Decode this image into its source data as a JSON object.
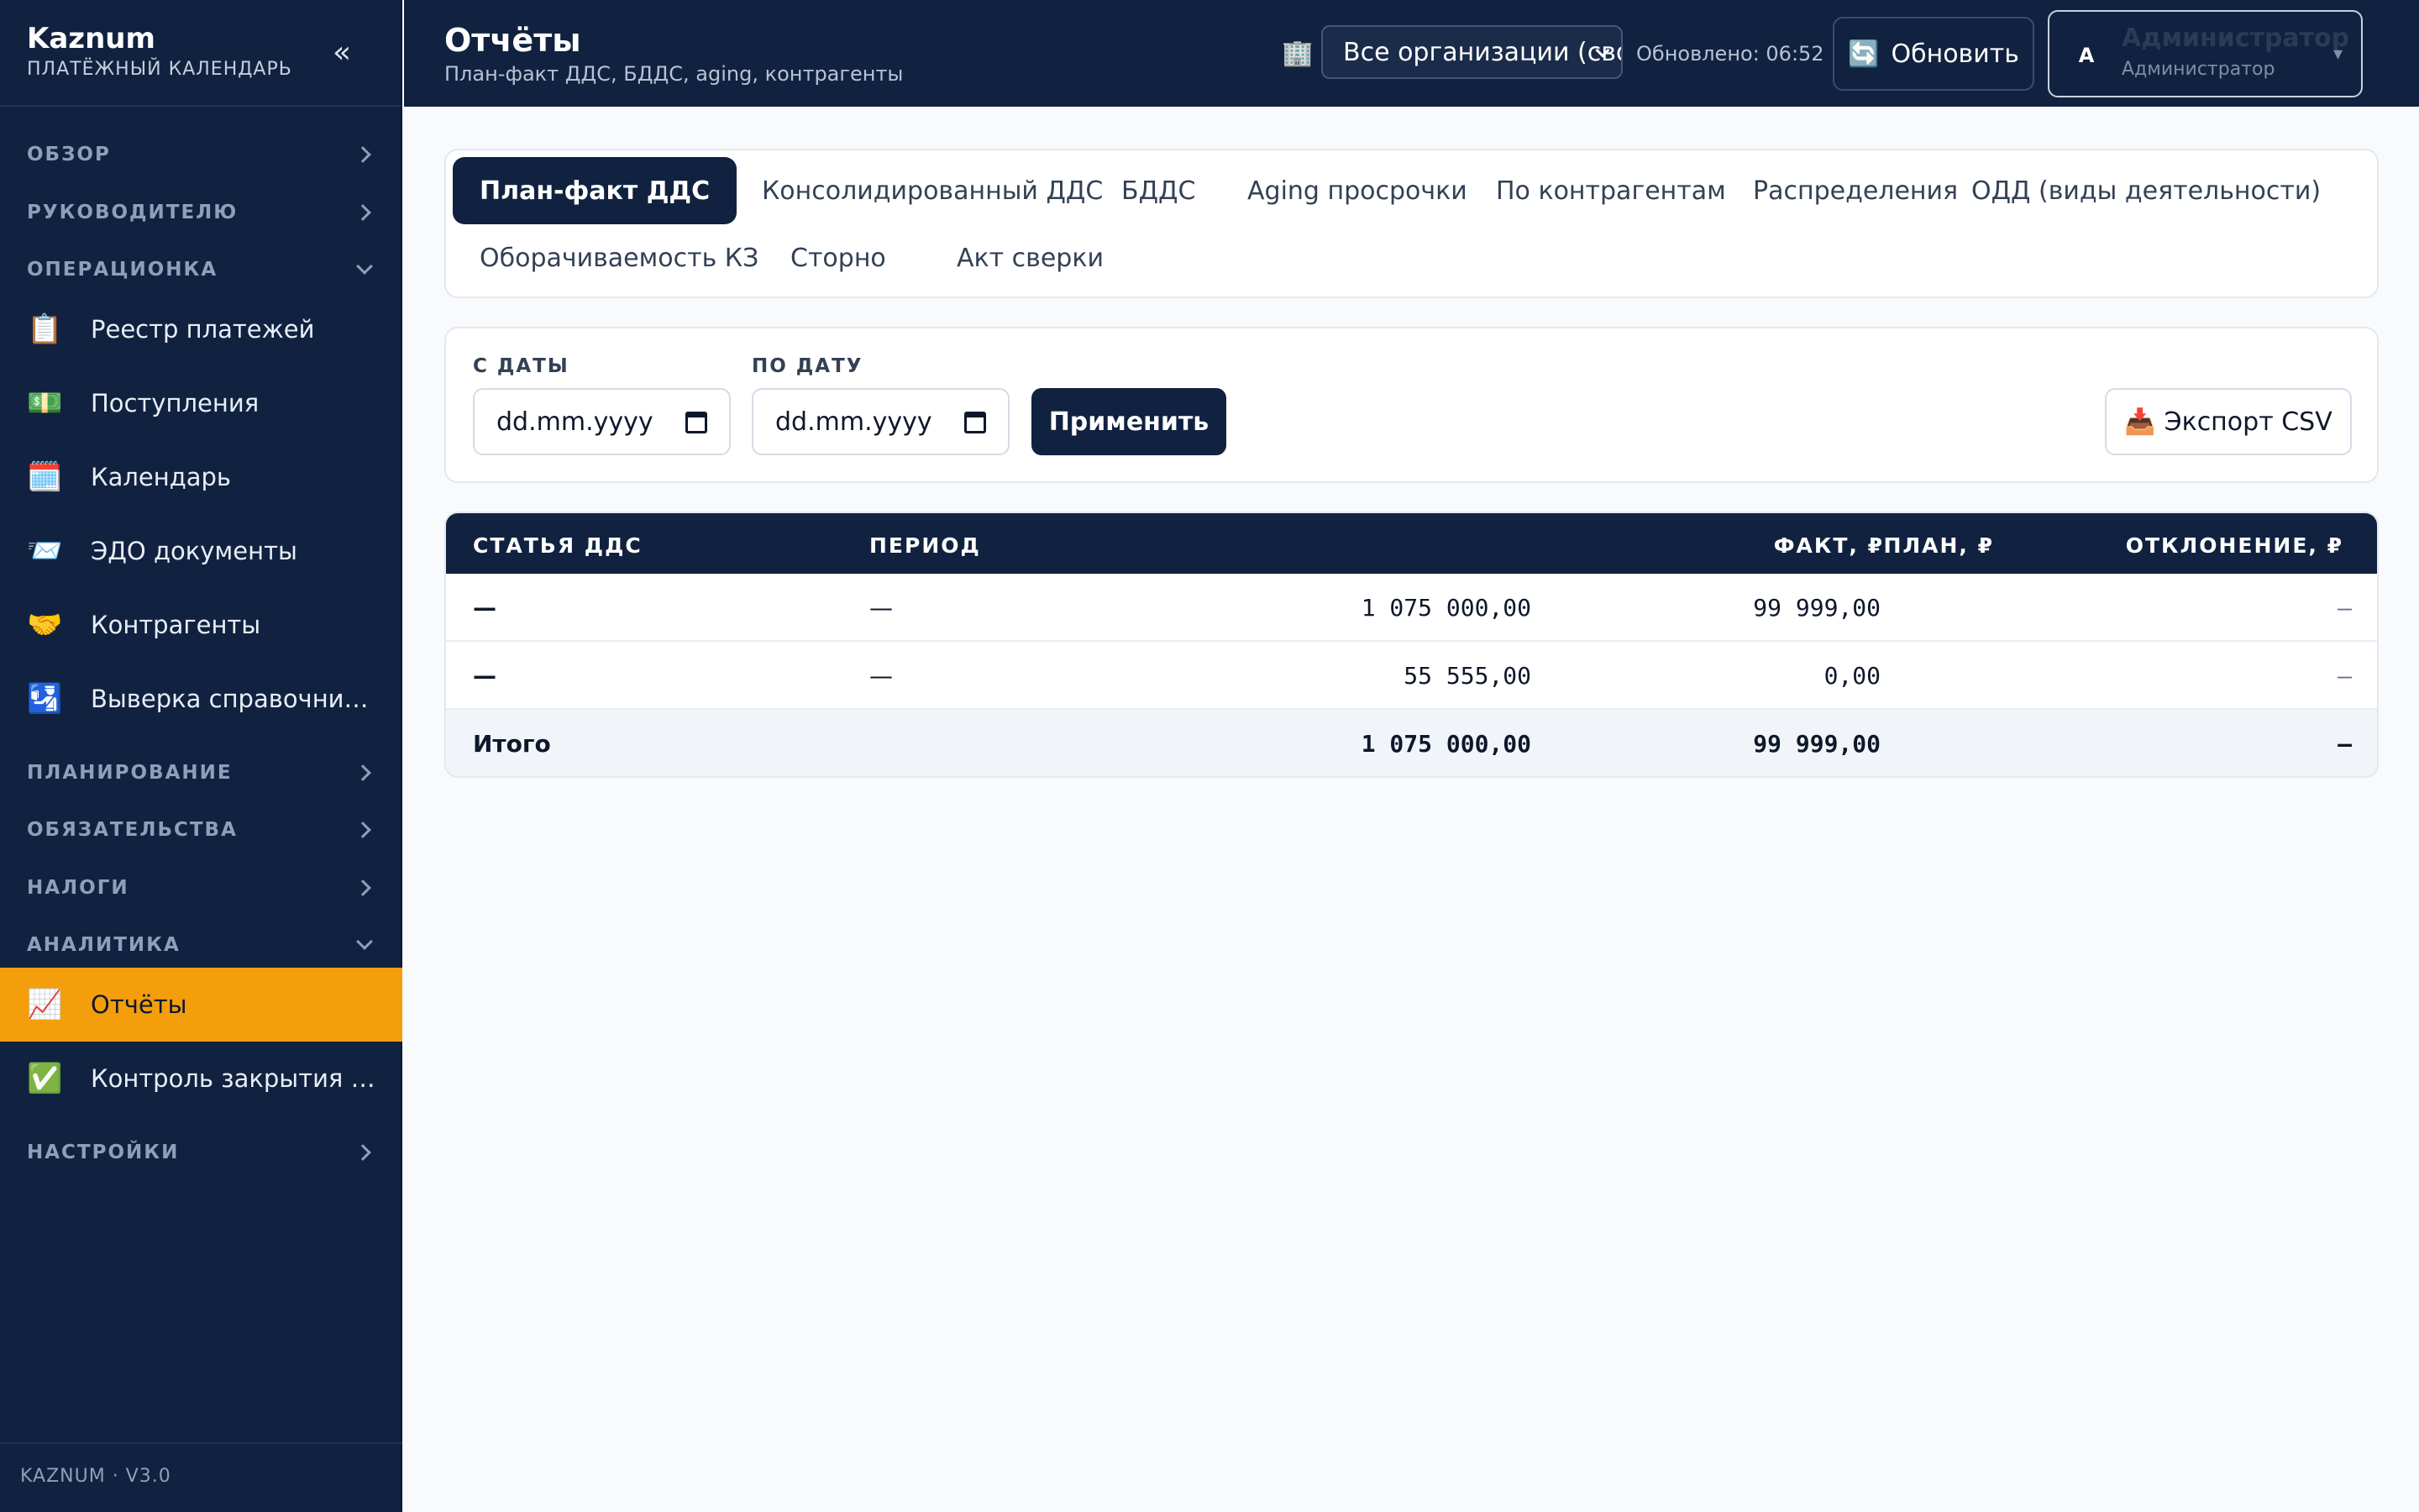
{
  "sidebar": {
    "brand_name": "Kaznum",
    "brand_sub": "ПЛАТЁЖНЫЙ КАЛЕНДАРЬ",
    "collapse_glyph": "«",
    "sections": {
      "overview": "ОБЗОР",
      "manager": "РУКОВОДИТЕЛЮ",
      "operations": "ОПЕРАЦИОНКА",
      "planning": "ПЛАНИРОВАНИЕ",
      "obligations": "ОБЯЗАТЕЛЬСТВА",
      "taxes": "НАЛОГИ",
      "analytics": "АНАЛИТИКА",
      "settings": "НАСТРОЙКИ"
    },
    "items": {
      "payments": {
        "icon": "📋",
        "label": "Реестр платежей"
      },
      "receipts": {
        "icon": "💵",
        "label": "Поступления"
      },
      "calendar": {
        "icon": "🗓️",
        "label": "Календарь"
      },
      "edo": {
        "icon": "📨",
        "label": "ЭДО документы"
      },
      "counterparties": {
        "icon": "🤝",
        "label": "Контрагенты"
      },
      "reconcile": {
        "icon": "🛂",
        "label": "Выверка справочников"
      },
      "reports": {
        "icon": "📈",
        "label": "Отчёты"
      },
      "closing": {
        "icon": "✅",
        "label": "Контроль закрытия пе..."
      }
    },
    "footer": "KAZNUM · V3.0"
  },
  "header": {
    "title": "Отчёты",
    "subtitle": "План-факт ДДС, БДДС, aging, контрагенты",
    "org_icon": "🏢",
    "org_select": "Все организации (сво",
    "updated": "Обновлено: 06:52",
    "refresh_icon": "🔄",
    "refresh_label": "Обновить",
    "user": {
      "avatar": "A",
      "name": "Администратор",
      "role": "Администратор",
      "caret": "▾"
    }
  },
  "tabs": {
    "plan_fact": "План-факт ДДС",
    "consolidated": "Консолидированный ДДС",
    "bdds": "БДДС",
    "aging": "Aging просрочки",
    "by_counterparty": "По контрагентам",
    "distributions": "Распределения",
    "odd": "ОДД (виды деятельности)",
    "turnover": "Оборачиваемость КЗ",
    "storno": "Сторно",
    "act": "Акт сверки"
  },
  "filters": {
    "from_label": "С ДАТЫ",
    "from_value": "dd.mm.yyyy",
    "to_label": "ПО ДАТУ",
    "to_value": "dd.mm.yyyy",
    "apply": "Применить",
    "export_icon": "📥",
    "export": "Экспорт CSV"
  },
  "table": {
    "headers": {
      "article": "СТАТЬЯ ДДС",
      "period": "ПЕРИОД",
      "plan": "ПЛАН, ₽",
      "fact": "ФАКТ, ₽",
      "deviation": "ОТКЛОНЕНИЕ, ₽"
    },
    "rows": [
      {
        "article": "—",
        "period": "—",
        "plan": "1 075 000,00",
        "fact": "99 999,00",
        "deviation": "—"
      },
      {
        "article": "—",
        "period": "—",
        "plan": "55 555,00",
        "fact": "0,00",
        "deviation": "—"
      }
    ],
    "total": {
      "label": "Итого",
      "plan": "1 075 000,00",
      "fact": "99 999,00",
      "deviation": "—"
    }
  }
}
